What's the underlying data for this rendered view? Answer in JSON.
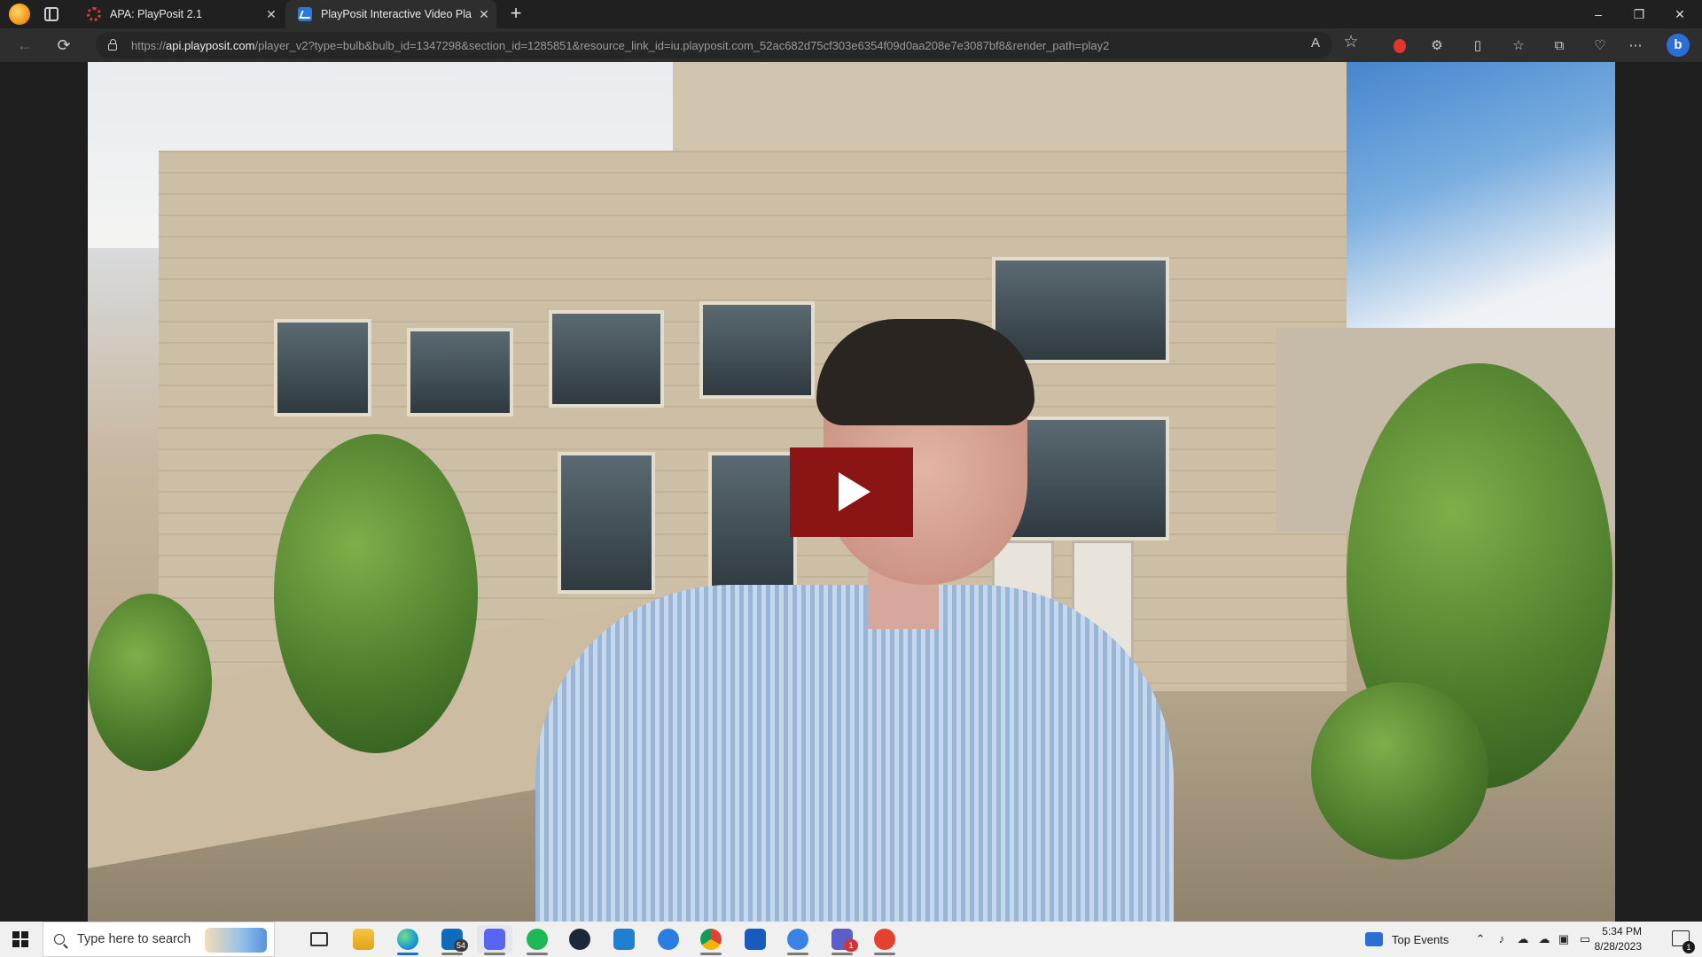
{
  "browser": {
    "tabs": [
      {
        "title": "APA: PlayPosit 2.1",
        "active": false,
        "favicon": "apa-loading-icon"
      },
      {
        "title": "PlayPosit Interactive Video Player",
        "active": true,
        "favicon": "playposit-icon"
      }
    ],
    "new_tab_label": "+",
    "window_controls": {
      "minimize": "–",
      "restore": "❐",
      "close": "✕"
    },
    "nav": {
      "back": "←",
      "reload": "⟳"
    },
    "url": {
      "scheme": "https://",
      "host": "api.playposit.com",
      "path": "/player_v2?type=bulb&bulb_id=1347298&section_id=1285851&resource_link_id=iu.playposit.com_52ac682d75cf303e6354f09d0aa208e7e3087bf8&render_path=play2"
    },
    "omnibox_icons": {
      "read_aloud": "A",
      "favorite": "☆"
    },
    "toolbar_icons": [
      "extension-red-icon",
      "extensions-icon",
      "split-screen-icon",
      "favorites-icon",
      "collections-icon",
      "performance-icon",
      "more-icon",
      "bing-icon"
    ],
    "more_label": "⋯",
    "bing_label": "b"
  },
  "player": {
    "play_button_label": "Play video",
    "colors": {
      "play_button": "#8b1414",
      "play_triangle": "#ffffff"
    }
  },
  "taskbar": {
    "search_placeholder": "Type here to search",
    "apps": [
      {
        "name": "task-view",
        "badge": ""
      },
      {
        "name": "file-explorer",
        "badge": ""
      },
      {
        "name": "edge",
        "badge": ""
      },
      {
        "name": "mail",
        "badge": "54"
      },
      {
        "name": "discord",
        "badge": ""
      },
      {
        "name": "spotify",
        "badge": ""
      },
      {
        "name": "steam",
        "badge": ""
      },
      {
        "name": "vscode",
        "badge": ""
      },
      {
        "name": "bluestacks",
        "badge": ""
      },
      {
        "name": "chrome",
        "badge": ""
      },
      {
        "name": "word",
        "badge": ""
      },
      {
        "name": "bluestacks-x",
        "badge": ""
      },
      {
        "name": "teams",
        "badge": "1"
      },
      {
        "name": "ea-app",
        "badge": ""
      }
    ],
    "widgets_label": "Top Events",
    "time": "5:34 PM",
    "date": "8/28/2023",
    "notification_count": "1"
  }
}
